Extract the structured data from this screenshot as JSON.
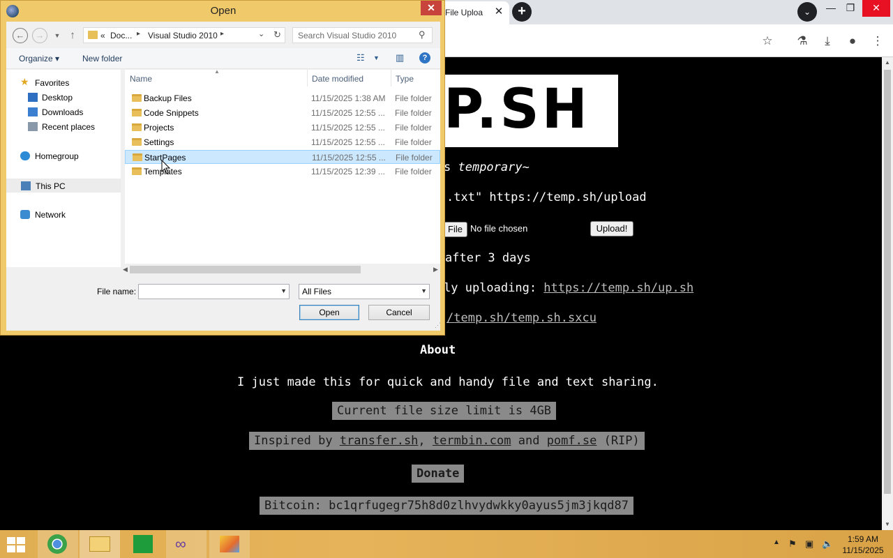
{
  "browser": {
    "tab_title": "File Uploa",
    "tab_close": "✕",
    "new_tab": "+",
    "tab_search": "⌄",
    "controls": {
      "minimize": "—",
      "restore": "❐",
      "close": "✕"
    },
    "toolbar_icons": [
      "star-icon",
      "flask-icon",
      "download-icon",
      "profile-icon",
      "menu-icon"
    ]
  },
  "page": {
    "logo_text": "P.SH",
    "tagline_prefix": "s ",
    "tagline_em": "temporary~",
    "curl_cmd": ".txt\" https://temp.sh/upload",
    "choose_file": "File",
    "no_file": "No file chosen",
    "upload_btn": "Upload!",
    "expiry": "after 3 days",
    "script_prefix": "ly uploading: ",
    "script_link": "https://temp.sh/up.sh",
    "sxcu_link": "/temp.sh/temp.sh.sxcu",
    "about_heading": "About",
    "about_text": "I just made this for quick and handy file and text sharing.",
    "size_limit": "Current file size limit is 4GB",
    "inspired_prefix": "Inspired by ",
    "inspired_link1": "transfer.sh",
    "inspired_sep1": ", ",
    "inspired_link2": "termbin.com",
    "inspired_sep2": " and ",
    "inspired_link3": "pomf.se",
    "inspired_suffix": " (RIP)",
    "donate": "Donate",
    "bitcoin": "Bitcoin: bc1qrfugegr75h8d0zlhvydwkky0ayus5jm3jkqd87"
  },
  "dialog": {
    "title": "Open",
    "close": "✕",
    "address": {
      "overflow": "«",
      "crumb1": "Doc...",
      "crumb2": "Visual Studio 2010"
    },
    "search_placeholder": "Search Visual Studio 2010",
    "organize": "Organize ▾",
    "new_folder": "New folder",
    "help": "?",
    "nav": {
      "favorites": "Favorites",
      "desktop": "Desktop",
      "downloads": "Downloads",
      "recent": "Recent places",
      "homegroup": "Homegroup",
      "this_pc": "This PC",
      "network": "Network"
    },
    "columns": {
      "name": "Name",
      "date": "Date modified",
      "type": "Type"
    },
    "files": [
      {
        "name": "Backup Files",
        "date": "11/15/2025 1:38 AM",
        "type": "File folder"
      },
      {
        "name": "Code Snippets",
        "date": "11/15/2025 12:55 ...",
        "type": "File folder"
      },
      {
        "name": "Projects",
        "date": "11/15/2025 12:55 ...",
        "type": "File folder"
      },
      {
        "name": "Settings",
        "date": "11/15/2025 12:55 ...",
        "type": "File folder"
      },
      {
        "name": "StartPages",
        "date": "11/15/2025 12:55 ...",
        "type": "File folder",
        "selected": true
      },
      {
        "name": "Templates",
        "date": "11/15/2025 12:39 ...",
        "type": "File folder"
      }
    ],
    "filename_label": "File name:",
    "filename_value": "",
    "filter_value": "All Files",
    "open_btn": "Open",
    "cancel_btn": "Cancel"
  },
  "taskbar": {
    "time": "1:59 AM",
    "date": "11/15/2025",
    "apps": [
      "start-icon",
      "chrome-icon",
      "file-explorer-icon",
      "store-icon",
      "visual-studio-icon",
      "paint-icon"
    ]
  },
  "colors": {
    "dialog_frame": "#f0c96b",
    "taskbar": "#e0ad52",
    "selection": "#cce8ff",
    "page_bg": "#000000"
  }
}
